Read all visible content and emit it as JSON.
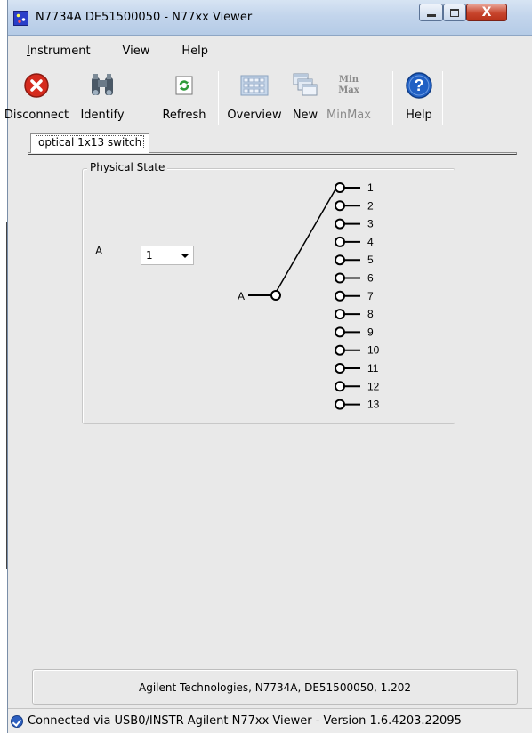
{
  "window": {
    "title": "N7734A DE51500050 - N77xx Viewer",
    "close_glyph": "X"
  },
  "menu": {
    "items": [
      {
        "label": "Instrument",
        "mnemonic": "I",
        "rest": "nstrument"
      },
      {
        "label": "View"
      },
      {
        "label": "Help"
      }
    ]
  },
  "toolbar": {
    "disconnect": "Disconnect",
    "identify": "Identify",
    "refresh": "Refresh",
    "overview": "Overview",
    "new": "New",
    "minmax": "MinMax",
    "minmax_icon_line1": "Min",
    "minmax_icon_line2": "Max",
    "help": "Help"
  },
  "tabs": [
    {
      "label": "optical 1x13 switch",
      "active": true
    }
  ],
  "physical_state": {
    "legend": "Physical State",
    "input_label": "A",
    "selected_port": "1",
    "common_port_label": "A",
    "ports": [
      "1",
      "2",
      "3",
      "4",
      "5",
      "6",
      "7",
      "8",
      "9",
      "10",
      "11",
      "12",
      "13"
    ]
  },
  "info": {
    "text": "Agilent Technologies, N7734A, DE51500050, 1.202"
  },
  "status": {
    "text": "Connected via USB0/INSTR  Agilent N77xx Viewer - Version 1.6.4203.22095"
  },
  "colors": {
    "window_bg": "#e9e9e9",
    "disconnect_red": "#d52b1e",
    "help_blue": "#2160c4",
    "refresh_green": "#2f9b3a"
  },
  "icons": [
    "disconnect-icon",
    "binoculars-icon",
    "refresh-icon",
    "overview-icon",
    "new-window-icon",
    "minmax-icon",
    "help-icon",
    "connected-icon"
  ]
}
